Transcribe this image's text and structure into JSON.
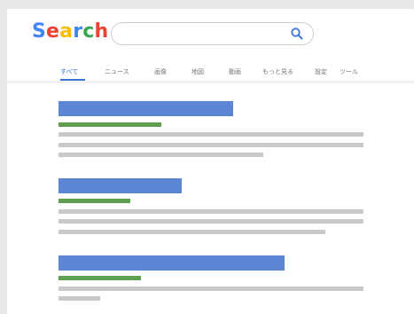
{
  "header": {
    "logo_letters": [
      {
        "char": "S",
        "color": "#4285F4"
      },
      {
        "char": "e",
        "color": "#EA4335"
      },
      {
        "char": "a",
        "color": "#FBBC05"
      },
      {
        "char": "r",
        "color": "#4285F4"
      },
      {
        "char": "c",
        "color": "#34A853"
      },
      {
        "char": "h",
        "color": "#EA4335"
      }
    ]
  },
  "search": {
    "value": "",
    "placeholder": "",
    "icon": "search-icon",
    "accent_color": "#4A7BD6"
  },
  "tabs": [
    {
      "label": "すべて",
      "active": true
    },
    {
      "label": "ニュース",
      "active": false
    },
    {
      "label": "画像",
      "active": false
    },
    {
      "label": "地図",
      "active": false
    },
    {
      "label": "動画",
      "active": false
    },
    {
      "label": "もっと見る",
      "active": false
    },
    {
      "label": "設定",
      "active": false
    },
    {
      "label": "ツール",
      "active": false
    }
  ],
  "colors": {
    "title_bar": "#5B86D6",
    "url_bar": "#5F9F51",
    "snippet_bar": "#C9C9C9",
    "active_tab": "#3B6FD1"
  }
}
